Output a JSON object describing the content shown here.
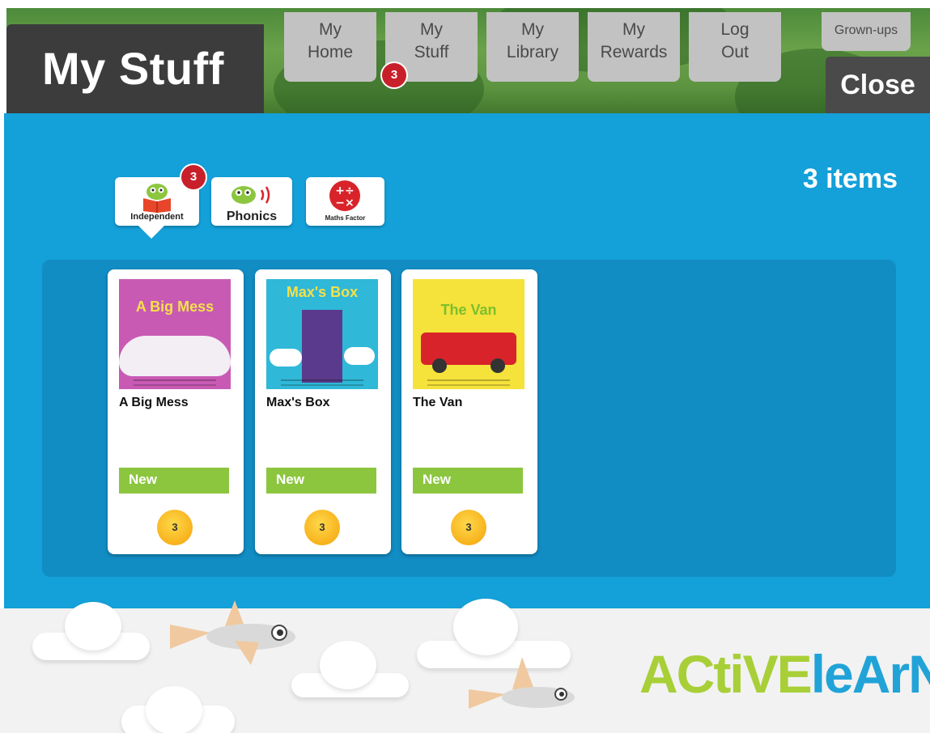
{
  "header": {
    "title": "My Stuff",
    "nav": [
      {
        "label": "My\nHome"
      },
      {
        "label": "My\nStuff",
        "badge": "3"
      },
      {
        "label": "My\nLibrary"
      },
      {
        "label": "My\nRewards"
      },
      {
        "label": "Log\nOut"
      }
    ],
    "grownups_label": "Grown-ups",
    "close_label": "Close"
  },
  "filters": {
    "tabs": [
      {
        "label": "Independent",
        "badge": "3",
        "selected": true
      },
      {
        "label": "Phonics"
      },
      {
        "label": "Maths Factor",
        "icon_text": "+÷\n−×"
      }
    ]
  },
  "summary": {
    "items_count": "3 items"
  },
  "books": [
    {
      "title": "A Big Mess",
      "cover_title": "A Big Mess",
      "status": "New",
      "coin": "3",
      "cover_color": "#c85ab4"
    },
    {
      "title": "Max's Box",
      "cover_title": "Max's Box",
      "status": "New",
      "coin": "3",
      "cover_color": "#2fb8d8"
    },
    {
      "title": "The Van",
      "cover_title": "The Van",
      "status": "New",
      "coin": "3",
      "cover_color": "#f5e23a"
    }
  ],
  "footer": {
    "logo_part1": "ACtiVE",
    "logo_part2": "leArN"
  },
  "colors": {
    "main_blue": "#14a0d8",
    "new_green": "#8cc63f",
    "badge_red": "#c8202a",
    "coin_yellow": "#f7b21c"
  }
}
